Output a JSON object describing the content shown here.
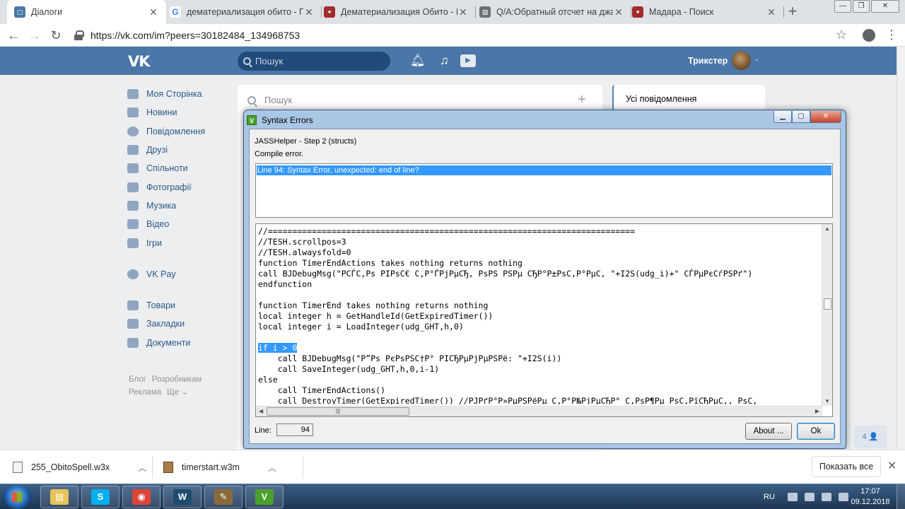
{
  "browser": {
    "tabs": [
      {
        "title": "Діалоги",
        "favicon": "vk-icon",
        "color": "#4a76a8",
        "glyph": "▢"
      },
      {
        "title": "дематериализация обито - По",
        "favicon": "google-icon",
        "color": "#ffffff",
        "glyph": "G"
      },
      {
        "title": "Дематериализация Обито - На",
        "favicon": "naruto-icon",
        "color": "#a32b2b",
        "glyph": "✦"
      },
      {
        "title": "Q/A:Обратный отсчет на джаз",
        "favicon": "xgm-icon",
        "color": "#6d6d6d",
        "glyph": "▧"
      },
      {
        "title": "Мадара - Поиск",
        "favicon": "naruto-icon",
        "color": "#a32b2b",
        "glyph": "✦"
      }
    ],
    "url": "https://vk.com/im?peers=30182484_134968753"
  },
  "vk": {
    "search_placeholder": "Пошук",
    "username": "Трикстер",
    "menu": [
      {
        "label": "Моя Сторінка",
        "icon": "home-icon"
      },
      {
        "label": "Новини",
        "icon": "news-icon"
      },
      {
        "label": "Повідомлення",
        "icon": "messages-icon"
      },
      {
        "label": "Друзі",
        "icon": "friends-icon"
      },
      {
        "label": "Спільноти",
        "icon": "communities-icon"
      },
      {
        "label": "Фотографії",
        "icon": "camera-icon"
      },
      {
        "label": "Музика",
        "icon": "music-icon"
      },
      {
        "label": "Відео",
        "icon": "video-icon"
      },
      {
        "label": "Ігри",
        "icon": "games-icon"
      }
    ],
    "menu2": [
      {
        "label": "VK Pay",
        "icon": "vkpay-icon"
      }
    ],
    "menu3": [
      {
        "label": "Товари",
        "icon": "goods-icon"
      },
      {
        "label": "Закладки",
        "icon": "star-icon"
      },
      {
        "label": "Документи",
        "icon": "document-icon"
      }
    ],
    "footer": [
      "Блог",
      "Розробникам",
      "Реклама",
      "Ще ⌄"
    ],
    "dialogs_search": "Пошук",
    "all_messages": "Усі повідомлення",
    "unread_badge": "4 👤"
  },
  "dialog": {
    "title": "Syntax Errors",
    "step": "JASSHelper - Step 2 (structs)",
    "status": "Compile error.",
    "errors": [
      "Line 94: Syntax Error, unexpected: end of line?"
    ],
    "code_lines": [
      "//===========================================================================",
      "//TESH.scrollpos=3",
      "//TESH.alwaysfold=0",
      "function TimerEndActions takes nothing returns nothing",
      "call BJDebugMsg(\"РСЃС‚Рѕ РІРѕС€ С‚Р°ЃРјРµСЂ, РѕРЅ РЅРµ СЂР°Р±РѕС‚Р°РµС‚ \"+I2S(udg_i)+\" СЃРµРєСѓРЅРґ\")",
      "endfunction",
      "",
      "function TimerEnd takes nothing returns nothing",
      "local integer h = GetHandleId(GetExpiredTimer())",
      "local integer i = LoadInteger(udg_GHT,h,0)",
      "",
      "if i > 0",
      "    call BJDebugMsg(\"Р”Рѕ РєРѕРЅС†Р° РІСЂРµРјРµРЅРё: \"+I2S(i))",
      "    call SaveInteger(udg_GHT,h,0,i-1)",
      "else",
      "    call TimerEndActions()",
      "    call DestroyTimer(GetExpiredTimer()) //РЈРґР°Р»РµРЅРёРµ С‚Р°Р№РјРµСЂР° С‚РѕР¶Рµ РѕС‚РїСЂРµС‚, РѕС‚"
    ],
    "selected_line_index": 11,
    "line_label": "Line:",
    "line_value": "94",
    "about_label": "About ...",
    "ok_label": "Ok"
  },
  "downloads": {
    "items": [
      {
        "name": "255_ObitoSpell.w3x"
      },
      {
        "name": "timerstart.w3m"
      }
    ],
    "show_all": "Показать все"
  },
  "taskbar": {
    "language": "RU",
    "time": "17:07",
    "date": "09.12.2018",
    "apps": [
      {
        "name": "explorer-icon",
        "color": "#e8c35a",
        "glyph": "▤"
      },
      {
        "name": "skype-icon",
        "color": "#00aff0",
        "glyph": "S"
      },
      {
        "name": "chrome-icon",
        "color": "#db4437",
        "glyph": "◉"
      },
      {
        "name": "warcraft-icon",
        "color": "#1e4c6e",
        "glyph": "W"
      },
      {
        "name": "world-editor-icon",
        "color": "#8a6a3a",
        "glyph": "✎"
      },
      {
        "name": "jasshelper-icon",
        "color": "#4aa02c",
        "glyph": "V"
      }
    ]
  }
}
